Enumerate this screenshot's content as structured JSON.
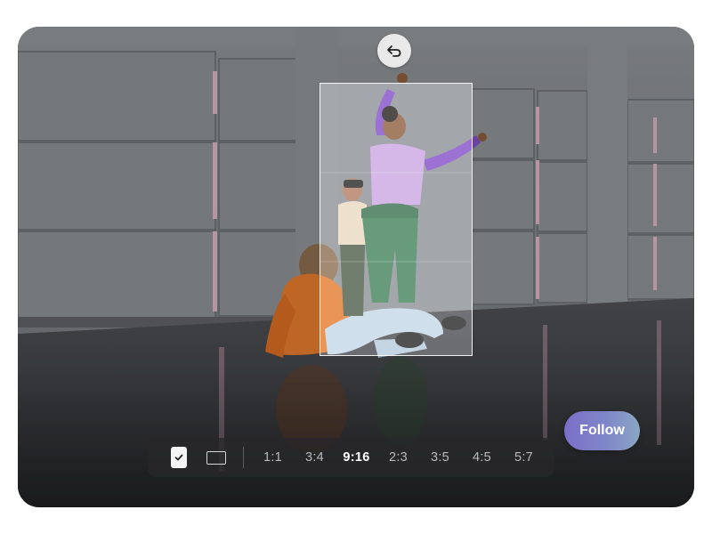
{
  "toolbar": {
    "ratios": [
      "1:1",
      "3:4",
      "9:16",
      "2:3",
      "3:5",
      "4:5",
      "5:7"
    ],
    "selected_ratio": "9:16"
  },
  "follow_button": {
    "label": "Follow"
  },
  "icons": {
    "undo": "undo-icon",
    "check": "check-icon",
    "landscape": "landscape-frame-icon"
  },
  "colors": {
    "follow_gradient_start": "#7b6fc9",
    "follow_gradient_end": "#8aa7c4",
    "toolbar_bg": "#28282a",
    "active_ratio": "#ffffff",
    "inactive_ratio": "#b9b9bb"
  }
}
